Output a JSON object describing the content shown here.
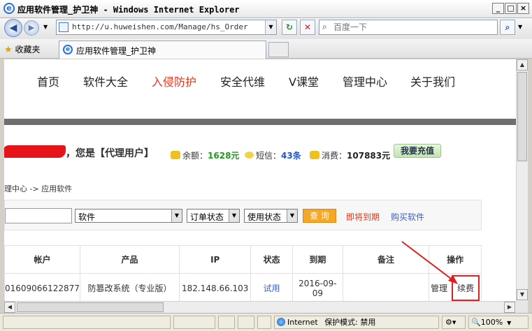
{
  "window": {
    "title": "应用软件管理_护卫神 - Windows Internet Explorer",
    "minimize": "_",
    "maximize": "□",
    "close": "×"
  },
  "navbar": {
    "url": "http://u.huweishen.com/Manage/hs_Order.asp?tag",
    "search_placeholder": "百度一下"
  },
  "favorites": {
    "label": "收藏夹",
    "tab_title": "应用软件管理_护卫神"
  },
  "site_nav": {
    "items": [
      "首页",
      "软件大全",
      "入侵防护",
      "安全代维",
      "V课堂",
      "管理中心",
      "关于我们"
    ],
    "active_index": 2
  },
  "user": {
    "greeting": "，您是【代理用户】",
    "balance_label": "余额：",
    "balance_value": "1628元",
    "sms_label": "短信：",
    "sms_value": "43条",
    "spend_label": "消费：",
    "spend_value": "107883元",
    "recharge_label": "我要充值"
  },
  "breadcrumb": "理中心 -> 应用软件",
  "filters": {
    "software_select": "软件",
    "order_status_select": "订单状态",
    "use_status_select": "使用状态",
    "query_button": "查 询",
    "expiring_link": "即将到期",
    "buy_link": "购买软件"
  },
  "table": {
    "headers": [
      "帐户",
      "产品",
      "IP",
      "状态",
      "到期",
      "备注",
      "操作"
    ],
    "rows": [
      {
        "account": "01609066122877",
        "product": "防篡改系统（专业版）",
        "ip": "182.148.66.103",
        "status": "试用",
        "expiry": "2016-09-09",
        "note": "",
        "manage": "管理",
        "renew": "续费"
      }
    ]
  },
  "statusbar": {
    "zone": "Internet",
    "protected_mode": "保护模式: 禁用",
    "zoom": "100%"
  },
  "colors": {
    "active_nav": "#e03a1e",
    "highlight_box": "#e02020",
    "query_button": "#f4a82a"
  }
}
